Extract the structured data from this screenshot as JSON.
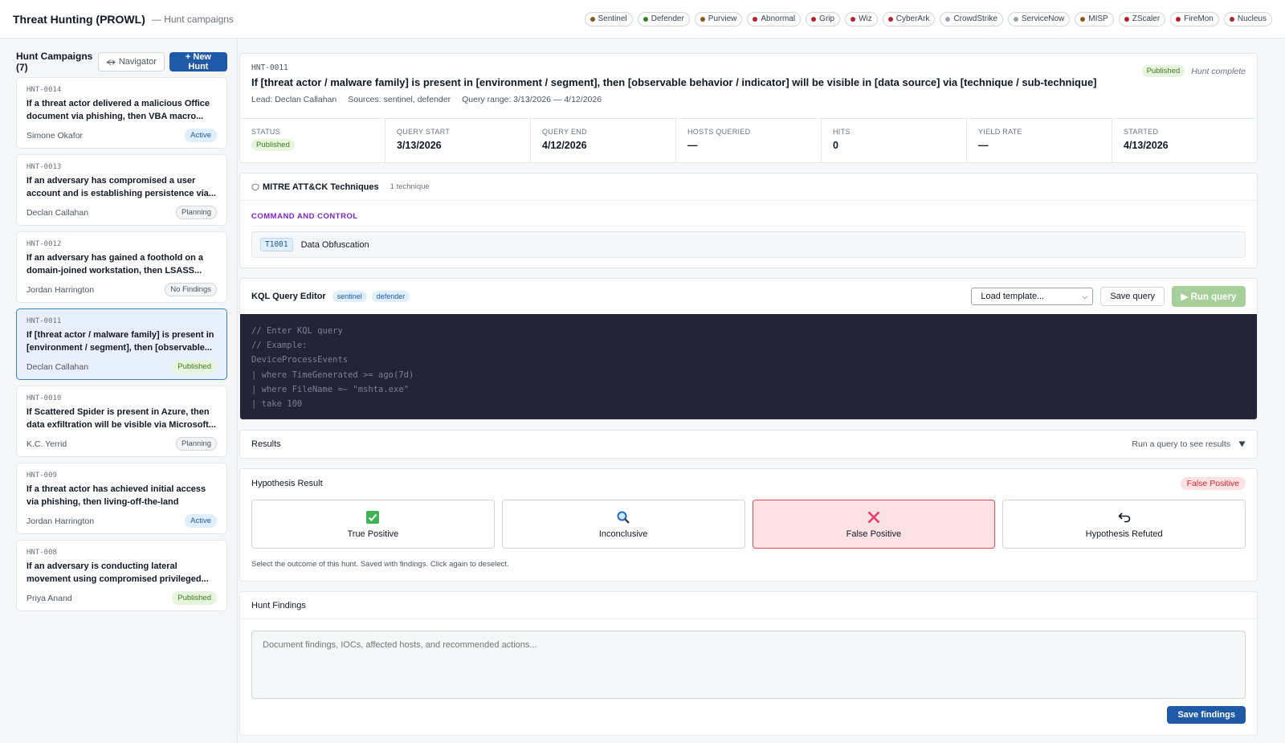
{
  "app": {
    "title": "Threat Hunting (PROWL)",
    "subtitle": "— Hunt campaigns"
  },
  "sources": [
    {
      "label": "Sentinel",
      "color": "#8b5a14"
    },
    {
      "label": "Defender",
      "color": "#3a7d24"
    },
    {
      "label": "Purview",
      "color": "#8b5a14"
    },
    {
      "label": "Abnormal",
      "color": "#b4232c"
    },
    {
      "label": "Grip",
      "color": "#b4232c"
    },
    {
      "label": "Wiz",
      "color": "#b4232c"
    },
    {
      "label": "CyberArk",
      "color": "#b4232c"
    },
    {
      "label": "CrowdStrike",
      "color": "#9ca3af"
    },
    {
      "label": "ServiceNow",
      "color": "#9ca3af"
    },
    {
      "label": "MISP",
      "color": "#8b5a14"
    },
    {
      "label": "ZScaler",
      "color": "#b4232c"
    },
    {
      "label": "FireMon",
      "color": "#b4232c"
    },
    {
      "label": "Nucleus",
      "color": "#b4232c"
    }
  ],
  "sidebar": {
    "title": "Hunt Campaigns (7)",
    "navigator_label": "Navigator",
    "navigator_icon": "compass-icon",
    "new_hunt_label": "+ New Hunt",
    "campaigns": [
      {
        "id": "HNT-0014",
        "text": "If a threat actor delivered a malicious Office document via phishing, then VBA macro...",
        "lead": "Simone Okafor",
        "status": "Active",
        "status_class": "b-active",
        "selected": false
      },
      {
        "id": "HNT-0013",
        "text": "If an adversary has compromised a user account and is establishing persistence via...",
        "lead": "Declan Callahan",
        "status": "Planning",
        "status_class": "b-planning",
        "selected": false
      },
      {
        "id": "HNT-0012",
        "text": "If an adversary has gained a foothold on a domain-joined workstation, then LSASS...",
        "lead": "Jordan Harrington",
        "status": "No Findings",
        "status_class": "b-nofind",
        "selected": false
      },
      {
        "id": "HNT-0011",
        "text": "If [threat actor / malware family] is present in [environment / segment], then [observable...",
        "lead": "Declan Callahan",
        "status": "Published",
        "status_class": "b-published",
        "selected": true
      },
      {
        "id": "HNT-0010",
        "text": "If Scattered Spider is present in Azure, then data exfiltration will be visible via Microsoft...",
        "lead": "K.C. Yerrid",
        "status": "Planning",
        "status_class": "b-planning",
        "selected": false
      },
      {
        "id": "HNT-009",
        "text": "If a threat actor has achieved initial access via phishing, then living-off-the-land binaries...",
        "lead": "Jordan Harrington",
        "status": "Active",
        "status_class": "b-active",
        "selected": false
      },
      {
        "id": "HNT-008",
        "text": "If an adversary is conducting lateral movement using compromised privileged...",
        "lead": "Priya Anand",
        "status": "Published",
        "status_class": "b-published",
        "selected": false
      }
    ]
  },
  "hunt": {
    "id": "HNT-0011",
    "status_badge": "Published",
    "status_note": "Hunt complete",
    "title": "If [threat actor / malware family] is present in [environment / segment], then [observable behavior / indicator] will be visible in [data source] via [technique / sub-technique]",
    "lead": "Lead: Declan Callahan",
    "sources": "Sources: sentinel, defender",
    "range": "Query range: 3/13/2026 — 4/12/2026",
    "stats": [
      {
        "label": "STATUS",
        "value": "Published",
        "is_badge": true
      },
      {
        "label": "QUERY START",
        "value": "3/13/2026"
      },
      {
        "label": "QUERY END",
        "value": "4/12/2026"
      },
      {
        "label": "HOSTS QUERIED",
        "value": "—"
      },
      {
        "label": "HITS",
        "value": "0"
      },
      {
        "label": "YIELD RATE",
        "value": "—"
      },
      {
        "label": "STARTED",
        "value": "4/13/2026"
      }
    ]
  },
  "mitre": {
    "title": "MITRE ATT&CK Techniques",
    "icon": "shield-icon",
    "count": "1 technique",
    "tactic": "COMMAND AND CONTROL",
    "techniques": [
      {
        "id": "T1001",
        "name": "Data Obfuscation"
      }
    ]
  },
  "kql": {
    "title": "KQL Query Editor",
    "tags": [
      "sentinel",
      "defender"
    ],
    "template_placeholder": "Load template...",
    "save_label": "Save query",
    "run_label": "▶ Run query",
    "lines": [
      "// Enter KQL query",
      "// Example:",
      "DeviceProcessEvents",
      "| where TimeGenerated >= ago(7d)",
      "| where FileName =~ \"mshta.exe\"",
      "| take 100"
    ]
  },
  "results": {
    "title": "Results",
    "hint": "Run a query to see results",
    "toggle_icon": "triangle-down-icon"
  },
  "hypothesis": {
    "title": "Hypothesis Result",
    "current": "False Positive",
    "outcomes": [
      {
        "label": "True Positive",
        "icon": "check-box-icon",
        "selected": false
      },
      {
        "label": "Inconclusive",
        "icon": "magnifier-icon",
        "selected": false
      },
      {
        "label": "False Positive",
        "icon": "x-icon",
        "selected": true
      },
      {
        "label": "Hypothesis Refuted",
        "icon": "return-arrow-icon",
        "selected": false
      }
    ],
    "note": "Select the outcome of this hunt. Saved with findings. Click again to deselect."
  },
  "findings": {
    "title": "Hunt Findings",
    "placeholder": "Document findings, IOCs, affected hosts, and recommended actions...",
    "save_label": "Save findings"
  }
}
